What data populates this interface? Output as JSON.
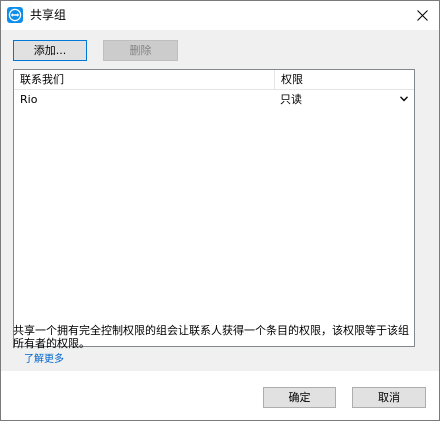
{
  "window": {
    "title": "共享组"
  },
  "toolbar": {
    "add_label": "添加...",
    "delete_label": "删除"
  },
  "list": {
    "columns": [
      "联系我们",
      "权限"
    ],
    "rows": [
      {
        "name": "Rio",
        "permission": "只读"
      }
    ]
  },
  "description": "共享一个拥有完全控制权限的组会让联系人获得一个条目的权限，该权限等于该组所有者的权限。",
  "learn_more": "了解更多",
  "footer": {
    "ok_label": "确定",
    "cancel_label": "取消"
  },
  "colors": {
    "accent": "#0078d7",
    "app_icon": "#0e8ee9",
    "link": "#0066cc"
  }
}
